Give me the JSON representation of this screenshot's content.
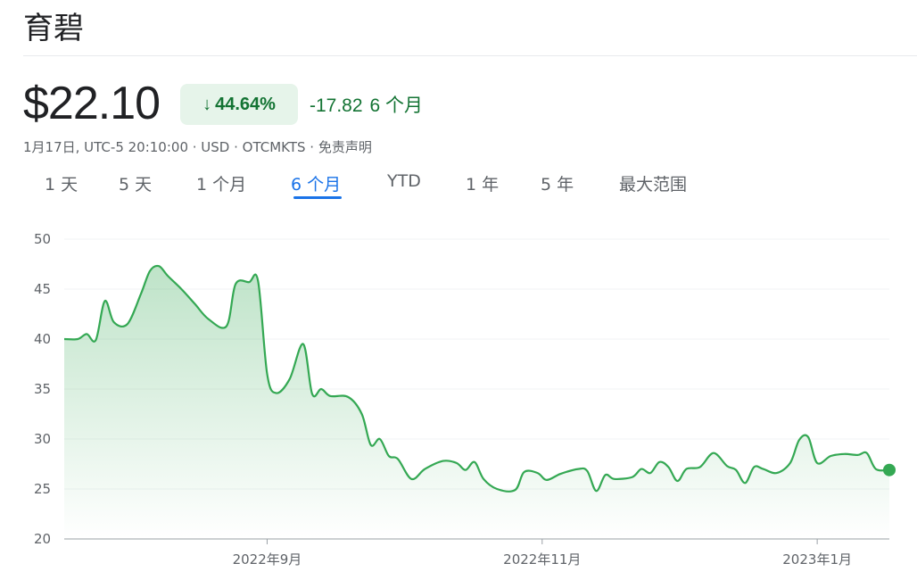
{
  "header": {
    "title": "育碧",
    "price": "$22.10",
    "change_percent": "44.64%",
    "change_direction_icon": "arrow-down-icon",
    "change_abs": "-17.82",
    "change_period": "6 个月",
    "meta": "1月17日, UTC-5 20:10:00 · USD · OTCMKTS · 免责声明"
  },
  "tabs": [
    {
      "label": "1 天",
      "active": false
    },
    {
      "label": "5 天",
      "active": false
    },
    {
      "label": "1 个月",
      "active": false
    },
    {
      "label": "6 个月",
      "active": true
    },
    {
      "label": "YTD",
      "active": false
    },
    {
      "label": "1 年",
      "active": false
    },
    {
      "label": "5 年",
      "active": false
    },
    {
      "label": "最大范围",
      "active": false
    }
  ],
  "colors": {
    "line": "#34a853",
    "fill_top": "#34a853",
    "positive_text": "#137333",
    "badge_bg": "#e6f4ea",
    "active_tab": "#1a73e8",
    "grid": "#f1f3f4",
    "axis": "#5f6368"
  },
  "chart_data": {
    "type": "area",
    "ylim": [
      20,
      50
    ],
    "yticks": [
      50,
      45,
      40,
      35,
      30,
      25,
      20
    ],
    "grid": true,
    "x_start": "2022-07-18",
    "x_end": "2023-01-17",
    "xtick_labels": [
      {
        "date": "2022-09-01",
        "label": "2022年9月"
      },
      {
        "date": "2022-11-01",
        "label": "2022年11月"
      },
      {
        "date": "2023-01-01",
        "label": "2023年1月"
      }
    ],
    "series": [
      {
        "points": [
          [
            "2022-07-18",
            40.0
          ],
          [
            "2022-07-21",
            40.0
          ],
          [
            "2022-07-23",
            40.5
          ],
          [
            "2022-07-25",
            39.9
          ],
          [
            "2022-07-27",
            43.8
          ],
          [
            "2022-07-29",
            41.7
          ],
          [
            "2022-08-01",
            41.5
          ],
          [
            "2022-08-04",
            44.5
          ],
          [
            "2022-08-06",
            46.8
          ],
          [
            "2022-08-08",
            47.3
          ],
          [
            "2022-08-10",
            46.3
          ],
          [
            "2022-08-13",
            45.0
          ],
          [
            "2022-08-16",
            43.5
          ],
          [
            "2022-08-19",
            42.0
          ],
          [
            "2022-08-23",
            41.3
          ],
          [
            "2022-08-25",
            45.5
          ],
          [
            "2022-08-28",
            45.7
          ],
          [
            "2022-08-30",
            45.8
          ],
          [
            "2022-09-01",
            36.5
          ],
          [
            "2022-09-03",
            34.6
          ],
          [
            "2022-09-06",
            36.0
          ],
          [
            "2022-09-09",
            39.5
          ],
          [
            "2022-09-11",
            34.5
          ],
          [
            "2022-09-13",
            35.0
          ],
          [
            "2022-09-15",
            34.3
          ],
          [
            "2022-09-19",
            34.2
          ],
          [
            "2022-09-22",
            32.5
          ],
          [
            "2022-09-24",
            29.4
          ],
          [
            "2022-09-26",
            30.0
          ],
          [
            "2022-09-28",
            28.3
          ],
          [
            "2022-09-30",
            28.0
          ],
          [
            "2022-10-03",
            26.0
          ],
          [
            "2022-10-06",
            27.0
          ],
          [
            "2022-10-10",
            27.8
          ],
          [
            "2022-10-13",
            27.6
          ],
          [
            "2022-10-15",
            26.9
          ],
          [
            "2022-10-17",
            27.7
          ],
          [
            "2022-10-19",
            26.0
          ],
          [
            "2022-10-22",
            25.0
          ],
          [
            "2022-10-26",
            24.9
          ],
          [
            "2022-10-28",
            26.7
          ],
          [
            "2022-10-31",
            26.6
          ],
          [
            "2022-11-02",
            25.9
          ],
          [
            "2022-11-05",
            26.5
          ],
          [
            "2022-11-09",
            27.0
          ],
          [
            "2022-11-11",
            26.8
          ],
          [
            "2022-11-13",
            24.8
          ],
          [
            "2022-11-15",
            26.4
          ],
          [
            "2022-11-17",
            26.0
          ],
          [
            "2022-11-21",
            26.2
          ],
          [
            "2022-11-23",
            27.0
          ],
          [
            "2022-11-25",
            26.6
          ],
          [
            "2022-11-27",
            27.7
          ],
          [
            "2022-11-29",
            27.2
          ],
          [
            "2022-12-01",
            25.8
          ],
          [
            "2022-12-03",
            27.0
          ],
          [
            "2022-12-06",
            27.2
          ],
          [
            "2022-12-09",
            28.6
          ],
          [
            "2022-12-12",
            27.3
          ],
          [
            "2022-12-14",
            26.9
          ],
          [
            "2022-12-16",
            25.6
          ],
          [
            "2022-12-18",
            27.2
          ],
          [
            "2022-12-20",
            27.0
          ],
          [
            "2022-12-23",
            26.6
          ],
          [
            "2022-12-26",
            27.6
          ],
          [
            "2022-12-28",
            29.9
          ],
          [
            "2022-12-30",
            30.2
          ],
          [
            "2023-01-01",
            27.6
          ],
          [
            "2023-01-04",
            28.3
          ],
          [
            "2023-01-07",
            28.5
          ],
          [
            "2023-01-10",
            28.4
          ],
          [
            "2023-01-12",
            28.6
          ],
          [
            "2023-01-14",
            27.0
          ],
          [
            "2023-01-17",
            26.9
          ]
        ]
      }
    ]
  }
}
